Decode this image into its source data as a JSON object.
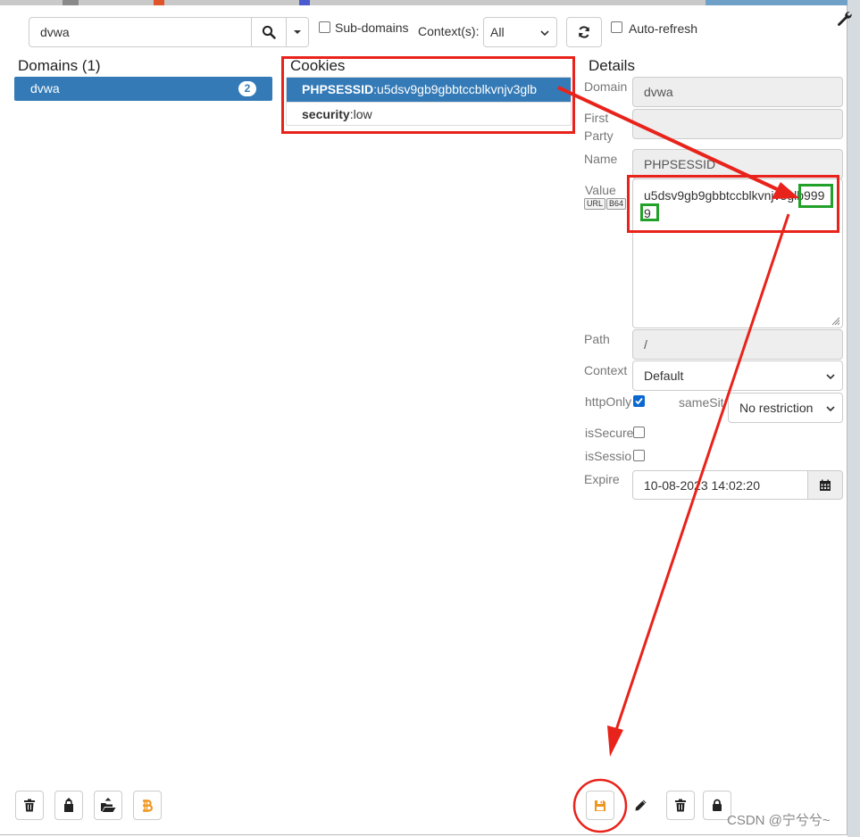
{
  "toolbar": {
    "search_value": "dvwa",
    "subdomains_label": "Sub-domains",
    "context_label": "Context(s):",
    "context_value": "All",
    "autorefresh_label": "Auto-refresh"
  },
  "domains": {
    "heading": "Domains (1)",
    "items": [
      {
        "name": "dvwa",
        "count": "2"
      }
    ]
  },
  "cookies": {
    "heading": "Cookies",
    "items": [
      {
        "name": "PHPSESSID",
        "value": "u5dsv9gb9gbbtccblkvnjv3glb"
      },
      {
        "name": "security",
        "value": "low"
      }
    ],
    "separator": ":"
  },
  "details": {
    "heading": "Details",
    "domain_label": "Domain",
    "domain_value": "dvwa",
    "first_party_label_1": "First",
    "first_party_label_2": "Party",
    "first_party_value": "",
    "name_label": "Name",
    "name_value": "PHPSESSID",
    "value_label": "Value",
    "url_btn": "URL",
    "b64_btn": "B64",
    "value_text": "u5dsv9gb9gbbtccblkvnjv3glb9999",
    "path_label": "Path",
    "path_value": "/",
    "context_label": "Context",
    "context_value": "Default",
    "httponly_label": "httpOnly",
    "samesite_label": "sameSit",
    "samesite_value": "No restriction",
    "issecure_label": "isSecure",
    "issession_label": "isSessio",
    "expire_label": "Expire",
    "expire_value": "10-08-2023 14:02:20"
  },
  "watermark": "CSDN @宁兮兮~",
  "colors": {
    "selected_blue": "#337ab7",
    "annotation_red": "#e8231b",
    "annotation_green": "#22a12a",
    "bitcoin_orange": "#f0961e"
  }
}
